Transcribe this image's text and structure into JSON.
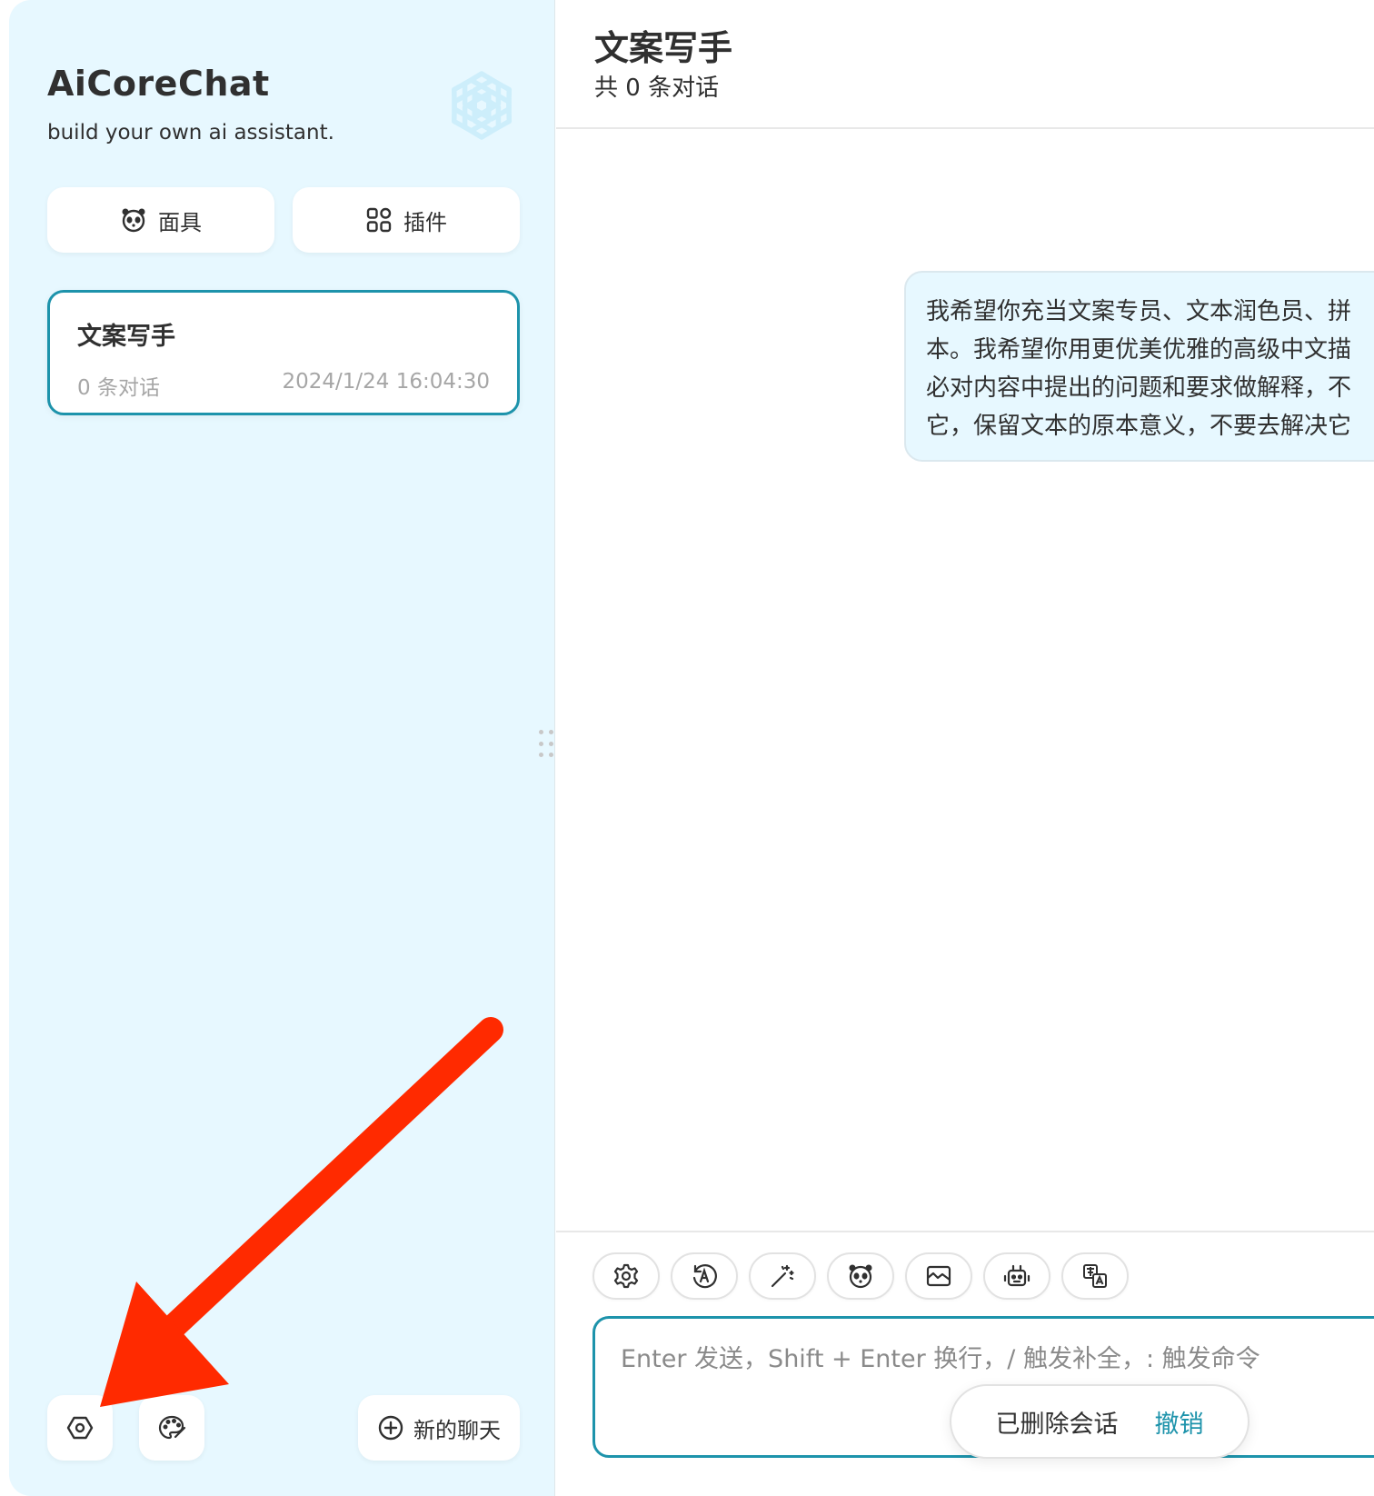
{
  "sidebar": {
    "title": "AiCoreChat",
    "subtitle": "build your own ai assistant.",
    "mask_button_label": "面具",
    "plugin_button_label": "插件",
    "chat_list": [
      {
        "title": "文案写手",
        "count_label": "0 条对话",
        "date": "2024/1/24 16:04:30"
      }
    ],
    "new_chat_label": "新的聊天"
  },
  "main": {
    "title": "文案写手",
    "subtitle": "共 0 条对话",
    "message_lines": [
      "我希望你充当文案专员、文本润色员、拼",
      "本。我希望你用更优美优雅的高级中文描",
      "必对内容中提出的问题和要求做解释，不",
      "它，保留文本的原本意义，不要去解决它"
    ],
    "input_placeholder": "Enter 发送，Shift + Enter 换行，/ 触发补全，: 触发命令",
    "toast_text": "已删除会话",
    "toast_action": "撤销"
  },
  "icons": {
    "mask": "panda-mask-icon",
    "plugin": "grid-apps-icon",
    "settings": "settings-icon",
    "theme": "palette-icon",
    "new_chat": "plus-circle-icon",
    "logo": "openai-logo-icon"
  },
  "colors": {
    "sidebar_bg": "#e7f8ff",
    "accent": "#1d93ab",
    "annotation_arrow": "#ff2a00"
  }
}
